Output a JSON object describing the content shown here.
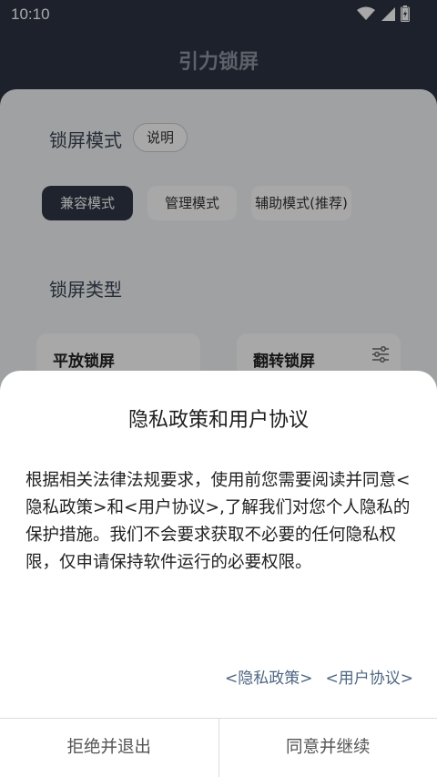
{
  "status_bar": {
    "time": "10:10",
    "icons": [
      "wifi-icon",
      "signal-icon",
      "battery-charging-icon"
    ]
  },
  "app": {
    "title": "引力锁屏"
  },
  "main": {
    "lock_mode_label": "锁屏模式",
    "explain_label": "说明",
    "modes": [
      "兼容模式",
      "管理模式",
      "辅助模式(推荐)"
    ],
    "selected_mode": "兼容模式",
    "lock_type_label": "锁屏类型",
    "types": [
      "平放锁屏",
      "翻转锁屏"
    ]
  },
  "dialog": {
    "title": "隐私政策和用户协议",
    "body": "根据相关法律法规要求，使用前您需要阅读并同意<隐私政策>和<用户协议>,了解我们对您个人隐私的保护措施。我们不会要求获取不必要的任何隐私权限，仅申请保持软件运行的必要权限。",
    "privacy_link": "<隐私政策>",
    "user_link": "<用户协议>",
    "reject_label": "拒绝并退出",
    "accept_label": "同意并继续"
  },
  "colors": {
    "background": "#2b3342",
    "accent": "#2e3646",
    "link": "#4f6683"
  }
}
